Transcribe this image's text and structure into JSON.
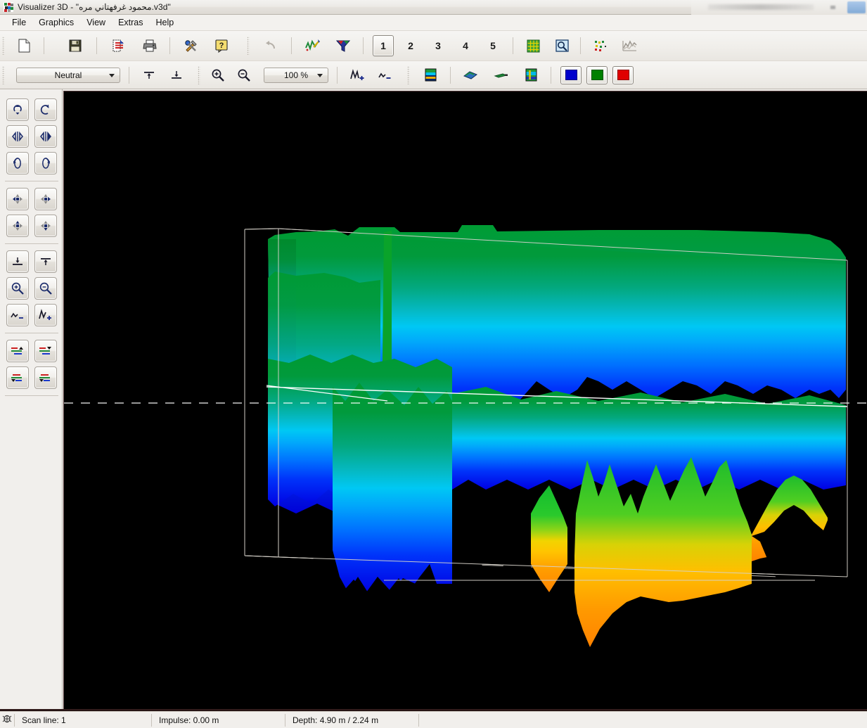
{
  "window": {
    "title": "Visualizer 3D - \"محمود غرفهتاني مره.v3d\"",
    "app_icon": "app-logo-icon"
  },
  "menu": {
    "items": [
      {
        "label": "File"
      },
      {
        "label": "Graphics"
      },
      {
        "label": "View"
      },
      {
        "label": "Extras"
      },
      {
        "label": "Help"
      }
    ]
  },
  "toolbar_main": {
    "buttons": [
      {
        "name": "new-file",
        "icon": "new-document-icon",
        "tip": "New"
      },
      {
        "name": "save-file",
        "icon": "floppy-disk-icon",
        "tip": "Save"
      },
      {
        "name": "export-file",
        "icon": "export-document-icon",
        "tip": "Export"
      },
      {
        "name": "print",
        "icon": "printer-icon",
        "tip": "Print"
      },
      {
        "name": "settings",
        "icon": "tools-hammer-wrench-icon",
        "tip": "Settings"
      },
      {
        "name": "help",
        "icon": "question-mark-icon",
        "tip": "Help"
      },
      {
        "name": "undo",
        "icon": "undo-arrow-icon",
        "tip": "Undo"
      },
      {
        "name": "filter-signal",
        "icon": "signal-curve-icon",
        "tip": "Signal Filter"
      },
      {
        "name": "funnel-filter",
        "icon": "funnel-icon",
        "tip": "Filter"
      }
    ],
    "view_numbers": [
      "1",
      "2",
      "3",
      "4",
      "5"
    ],
    "active_view": "1",
    "extra_buttons": [
      {
        "name": "grid-view",
        "icon": "grid-icon",
        "tip": "Grid"
      },
      {
        "name": "inspect-view",
        "icon": "magnifier-box-icon",
        "tip": "Inspect"
      },
      {
        "name": "scatter-points",
        "icon": "scatter-points-icon",
        "tip": "Points"
      },
      {
        "name": "line-graph",
        "icon": "line-chart-icon",
        "tip": "Graph"
      }
    ]
  },
  "toolbar_view": {
    "profile_select": {
      "value": "Neutral",
      "placeholder": "Neutral"
    },
    "zoom_select": {
      "value": "100 %",
      "placeholder": "100 %"
    },
    "buttons": [
      {
        "name": "align-top",
        "icon": "align-top-icon"
      },
      {
        "name": "align-bottom",
        "icon": "align-bottom-icon"
      },
      {
        "name": "zoom-in",
        "icon": "zoom-in-icon"
      },
      {
        "name": "zoom-out",
        "icon": "zoom-out-icon"
      },
      {
        "name": "amplify-up",
        "icon": "amplitude-increase-icon"
      },
      {
        "name": "amplify-down",
        "icon": "amplitude-decrease-icon"
      },
      {
        "name": "color-map",
        "icon": "color-map-icon"
      },
      {
        "name": "surface-view",
        "icon": "surface-plate-icon"
      },
      {
        "name": "slice-view",
        "icon": "slice-bar-icon"
      },
      {
        "name": "texture-view",
        "icon": "texture-map-icon"
      }
    ],
    "color_swatches": [
      {
        "name": "color-blue",
        "hex": "#0000cc"
      },
      {
        "name": "color-green",
        "hex": "#008000"
      },
      {
        "name": "color-red",
        "hex": "#e00000"
      }
    ]
  },
  "sidebar": {
    "groups": [
      {
        "buttons": [
          {
            "name": "rotate-vertical-ccw",
            "icon": "rotate-vertical-ccw-icon"
          },
          {
            "name": "rotate-vertical-cw",
            "icon": "rotate-vertical-cw-icon"
          },
          {
            "name": "flip-horizontal-left",
            "icon": "flip-horizontal-left-icon"
          },
          {
            "name": "flip-horizontal-right",
            "icon": "flip-horizontal-right-icon"
          },
          {
            "name": "rotate-3d-left",
            "icon": "rotate-3d-left-icon"
          },
          {
            "name": "rotate-3d-right",
            "icon": "rotate-3d-right-icon"
          }
        ]
      },
      {
        "buttons": [
          {
            "name": "pan-left",
            "icon": "pan-left-icon"
          },
          {
            "name": "pan-right",
            "icon": "pan-right-icon"
          },
          {
            "name": "pan-up",
            "icon": "pan-up-icon"
          },
          {
            "name": "pan-down",
            "icon": "pan-down-icon"
          }
        ]
      },
      {
        "buttons": [
          {
            "name": "lower-plane",
            "icon": "lower-plane-icon"
          },
          {
            "name": "raise-plane",
            "icon": "raise-plane-icon"
          },
          {
            "name": "zoom-in",
            "icon": "zoom-in-icon"
          },
          {
            "name": "zoom-out",
            "icon": "zoom-out-icon"
          },
          {
            "name": "amplitude-decrease",
            "icon": "amplitude-decrease-icon"
          },
          {
            "name": "amplitude-increase",
            "icon": "amplitude-increase-icon"
          }
        ]
      },
      {
        "buttons": [
          {
            "name": "palette-shift-up",
            "icon": "palette-shift-up-icon"
          },
          {
            "name": "palette-shift-down",
            "icon": "palette-shift-down-icon"
          },
          {
            "name": "palette-compress-up",
            "icon": "palette-compress-up-icon"
          },
          {
            "name": "palette-compress-down",
            "icon": "palette-compress-down-icon"
          }
        ]
      }
    ]
  },
  "statusbar": {
    "icon": "scan-bug-icon",
    "scan_line": "Scan line: 1",
    "impulse": "Impulse: 0.00 m",
    "depth": "Depth: 4.90 m / 2.24 m",
    "blank": ""
  },
  "viewport": {
    "background": "#000000",
    "wireframe_color": "#d8d4cc",
    "marker_line_color": "#ffffff",
    "palette": {
      "top": "#009933",
      "mid_high": "#00c4ee",
      "mid": "#0a56ff",
      "low": "#0000e0",
      "anomaly_green": "#22bb33",
      "anomaly_yellow": "#ffd400",
      "anomaly_orange": "#ff8c00"
    }
  }
}
